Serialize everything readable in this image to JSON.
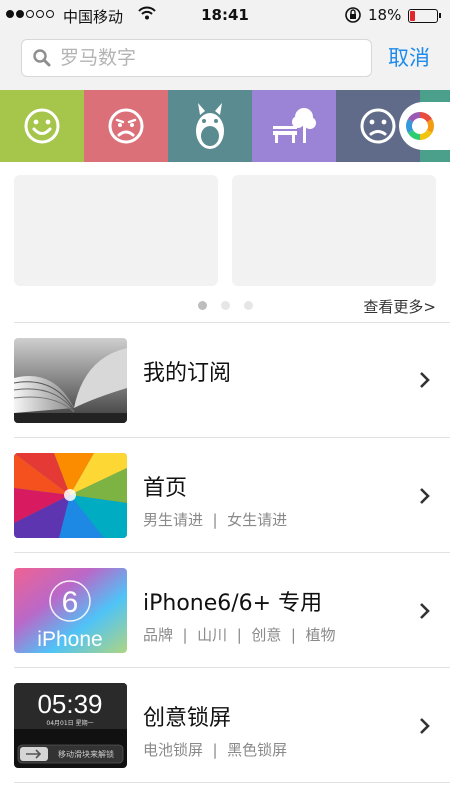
{
  "status_bar": {
    "carrier": "中国移动",
    "time": "18:41",
    "battery_percent": "18%",
    "battery_level": 0.18,
    "signal_bars": 2,
    "signal_total": 5,
    "battery_color": "#e0252b"
  },
  "search": {
    "placeholder": "罗马数字",
    "value": "",
    "cancel_label": "取消",
    "accent": "#1d8bec"
  },
  "categories": [
    {
      "icon": "smiley-icon",
      "color": "#a5c54b"
    },
    {
      "icon": "sad-face-icon",
      "color": "#dc7079"
    },
    {
      "icon": "totoro-icon",
      "color": "#5a8b90"
    },
    {
      "icon": "park-bench-tree-icon",
      "color": "#9b84d6"
    },
    {
      "icon": "frown-face-icon",
      "color": "#5f6b88"
    }
  ],
  "carousel": {
    "page_count": 3,
    "active_page": 1,
    "more_label": "查看更多>"
  },
  "list": [
    {
      "title": "我的订阅",
      "tags": [],
      "thumb": "open-book-photo"
    },
    {
      "title": "首页",
      "tags": [
        "男生请进",
        "女生请进"
      ],
      "thumb": "color-swirl-wallpaper"
    },
    {
      "title": "iPhone6/6+ 专用",
      "tags": [
        "品牌",
        "山川",
        "创意",
        "植物"
      ],
      "thumb": "iphone6-wallpaper",
      "thumb_text": "iPhone",
      "thumb_number": "6"
    },
    {
      "title": "创意锁屏",
      "tags": [
        "电池锁屏",
        "黑色锁屏"
      ],
      "thumb": "lockscreen-wallpaper",
      "thumb_time": "05:39",
      "thumb_date": "04月01日 星期一",
      "thumb_slide": "移动滑块来解锁"
    }
  ]
}
